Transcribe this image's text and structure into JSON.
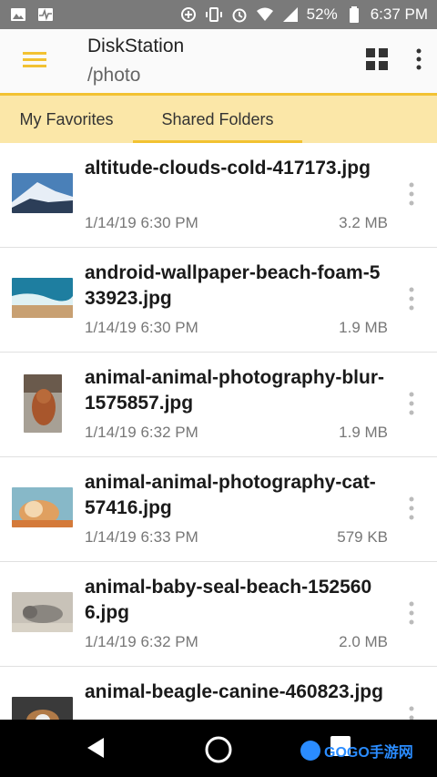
{
  "status_bar": {
    "battery": "52%",
    "time": "6:37 PM",
    "icons": [
      "image-icon",
      "activity-icon",
      "data-saver-icon",
      "vibrate-icon",
      "alarm-icon",
      "wifi-icon",
      "signal-icon",
      "battery-icon"
    ]
  },
  "app_bar": {
    "title": "DiskStation",
    "subtitle": "/photo",
    "accent": "#f2c232"
  },
  "tabs": [
    {
      "label": "My Favorites",
      "selected": false
    },
    {
      "label": "Shared Folders",
      "selected": true
    }
  ],
  "files": [
    {
      "name": "altitude-clouds-cold-417173.jpg",
      "date": "1/14/19 6:30 PM",
      "size": "3.2 MB"
    },
    {
      "name": "android-wallpaper-beach-foam-533923.jpg",
      "date": "1/14/19 6:30 PM",
      "size": "1.9 MB"
    },
    {
      "name": "animal-animal-photography-blur-1575857.jpg",
      "date": "1/14/19 6:32 PM",
      "size": "1.9 MB"
    },
    {
      "name": "animal-animal-photography-cat-57416.jpg",
      "date": "1/14/19 6:33 PM",
      "size": "579 KB"
    },
    {
      "name": "animal-baby-seal-beach-1525606.jpg",
      "date": "1/14/19 6:32 PM",
      "size": "2.0 MB"
    },
    {
      "name": "animal-beagle-canine-460823.jpg",
      "date": "",
      "size": ""
    }
  ],
  "watermark": {
    "text": "GOGO手游网"
  }
}
